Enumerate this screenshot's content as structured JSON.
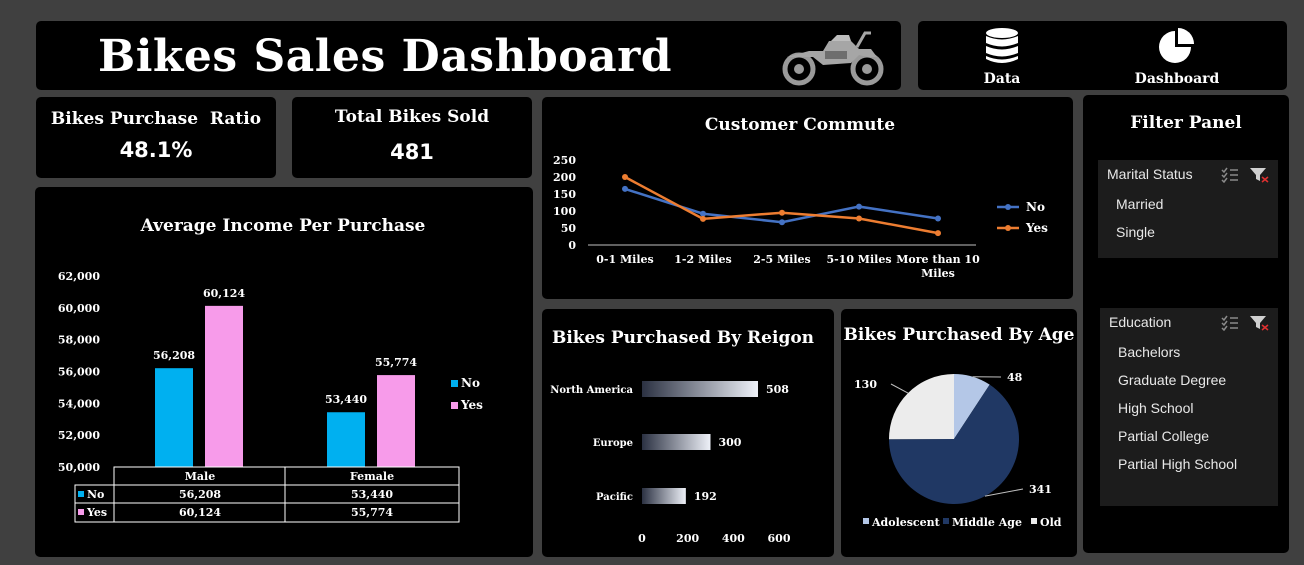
{
  "header": {
    "title": "Bikes Sales Dashboard"
  },
  "nav": {
    "data_label": "Data",
    "dashboard_label": "Dashboard"
  },
  "kpis": {
    "purchase_ratio": {
      "label": "Bikes Purchase  Ratio",
      "value": "48.1%"
    },
    "total_sold": {
      "label": "Total Bikes Sold",
      "value": "481"
    }
  },
  "colors": {
    "no_blue": "#00b0f0",
    "yes_pink": "#f79bea",
    "line_no": "#4472c4",
    "line_yes": "#ed7d31",
    "navy": "#203864",
    "light_blue": "#b4c7e7",
    "light_gray": "#ececec"
  },
  "income_chart": {
    "title": "Average Income Per Purchase",
    "table_header_no": "No",
    "table_header_yes": "Yes",
    "chart_data": {
      "type": "bar",
      "categories": [
        "Male",
        "Female"
      ],
      "series": [
        {
          "name": "No",
          "values": [
            56208,
            53440
          ],
          "labels": [
            "56,208",
            "53,440"
          ]
        },
        {
          "name": "Yes",
          "values": [
            60124,
            55774
          ],
          "labels": [
            "60,124",
            "55,774"
          ]
        }
      ],
      "y_ticks": [
        "50,000",
        "52,000",
        "54,000",
        "56,000",
        "58,000",
        "60,000",
        "62,000"
      ],
      "ylim": [
        50000,
        62000
      ],
      "legend": "right",
      "grid": false
    }
  },
  "commute_chart": {
    "title": "Customer Commute",
    "chart_data": {
      "type": "line",
      "categories": [
        "0-1 Miles",
        "1-2 Miles",
        "2-5 Miles",
        "5-10 Miles",
        "More than 10 Miles"
      ],
      "series": [
        {
          "name": "No",
          "values": [
            165,
            92,
            67,
            113,
            78
          ]
        },
        {
          "name": "Yes",
          "values": [
            200,
            77,
            95,
            78,
            35
          ]
        }
      ],
      "y_ticks": [
        "0",
        "50",
        "100",
        "150",
        "200",
        "250"
      ],
      "ylim": [
        0,
        250
      ],
      "legend": "right",
      "grid": false
    }
  },
  "region_chart": {
    "title": "Bikes Purchased By Reigon",
    "chart_data": {
      "type": "bar",
      "orientation": "horizontal",
      "categories": [
        "North America",
        "Europe",
        "Pacific"
      ],
      "values": [
        508,
        300,
        192
      ],
      "labels": [
        "508",
        "300",
        "192"
      ],
      "x_ticks": [
        "0",
        "200",
        "400",
        "600"
      ],
      "xlim": [
        0,
        600
      ],
      "grid": false
    }
  },
  "age_chart": {
    "title": "Bikes Purchased By Age",
    "chart_data": {
      "type": "pie",
      "categories": [
        "Adolescent",
        "Middle Age",
        "Old"
      ],
      "values": [
        48,
        341,
        130
      ],
      "labels": [
        "48",
        "341",
        "130"
      ],
      "legend": "bottom"
    }
  },
  "filter_panel": {
    "title": "Filter Panel",
    "marital": {
      "header": "Marital Status",
      "items": [
        "Married",
        "Single"
      ]
    },
    "education": {
      "header": "Education",
      "items": [
        "Bachelors",
        "Graduate Degree",
        "High School",
        "Partial College",
        "Partial High School"
      ]
    }
  }
}
